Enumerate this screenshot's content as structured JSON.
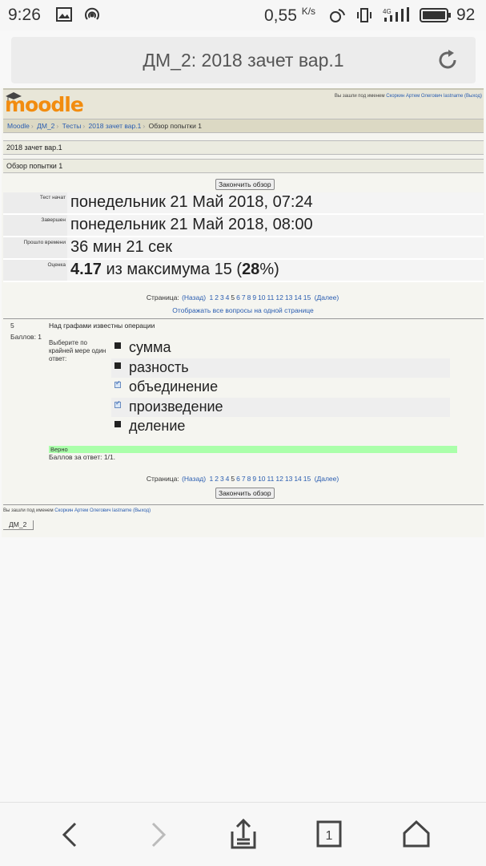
{
  "status_bar": {
    "time": "9:26",
    "speed": "0,55",
    "speed_unit": "K/s",
    "network": "4G",
    "battery": "92"
  },
  "browser": {
    "title": "ДМ_2: 2018 зачет вар.1",
    "reload_icon": "reload-icon"
  },
  "header": {
    "logo": "moodle",
    "login_prefix": "Вы зашли под именем",
    "login_user": "Скоркин Артем Олегович lastname",
    "login_logout": "(Выход)"
  },
  "breadcrumb": [
    {
      "label": "Moodle",
      "link": true
    },
    {
      "label": "ДМ_2",
      "link": true
    },
    {
      "label": "Тесты",
      "link": true
    },
    {
      "label": "2018 зачет вар.1",
      "link": true
    },
    {
      "label": "Обзор попытки 1",
      "link": false
    }
  ],
  "quiz_title": "2018 зачет вар.1",
  "attempt_title": "Обзор попытки 1",
  "finish_review_button": "Закончить обзор",
  "summary": [
    {
      "label": "Тест начат",
      "value": "понедельник 21 Май 2018, 07:24"
    },
    {
      "label": "Завершен",
      "value": "понедельник 21 Май 2018, 08:00"
    },
    {
      "label": "Прошло времени",
      "value": "36 мин 21 сек"
    }
  ],
  "grade": {
    "label": "Оценка",
    "score": "4.17",
    "middle": " из максимума 15 (",
    "percent": "28",
    "end": "%)"
  },
  "pager": {
    "label": "Страница:",
    "prev": "(Назад)",
    "pages": [
      "1",
      "2",
      "3",
      "4",
      "5",
      "6",
      "7",
      "8",
      "9",
      "10",
      "11",
      "12",
      "13",
      "14",
      "15"
    ],
    "current": "5",
    "next": "(Далее)",
    "show_all": "Отображать все вопросы на одной странице"
  },
  "question": {
    "number": "5",
    "grade": "Баллов: 1",
    "text": "Над графами известны операции",
    "prompt": "Выберите по крайней мере один ответ:",
    "answers": [
      {
        "label": "сумма",
        "checked": false
      },
      {
        "label": "разность",
        "checked": false
      },
      {
        "label": "объединение",
        "checked": true
      },
      {
        "label": "произведение",
        "checked": true
      },
      {
        "label": "деление",
        "checked": false
      }
    ],
    "feedback": "Верно",
    "score_line": "Баллов за ответ: 1/1."
  },
  "footer": {
    "login_prefix": "Вы зашли под именем",
    "login_user": "Скоркин Артем Олегович lastname",
    "login_logout": "(Выход)",
    "course": "ДМ_2"
  },
  "navbar": {
    "tabs_count": "1"
  }
}
